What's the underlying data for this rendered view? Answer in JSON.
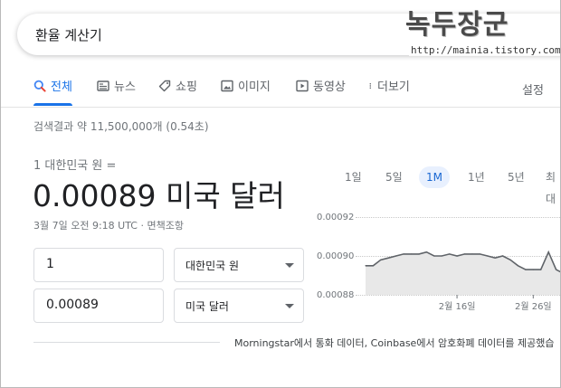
{
  "search": {
    "query": "환율 계산기"
  },
  "watermark": {
    "title": "녹두장군",
    "url": "http://mainia.tistory.com"
  },
  "tabs": [
    {
      "label": "전체",
      "icon": "search-icon",
      "active": true
    },
    {
      "label": "뉴스",
      "icon": "news-icon",
      "active": false
    },
    {
      "label": "쇼핑",
      "icon": "tag-icon",
      "active": false
    },
    {
      "label": "이미지",
      "icon": "image-icon",
      "active": false
    },
    {
      "label": "동영상",
      "icon": "play-icon",
      "active": false
    },
    {
      "label": "더보기",
      "icon": "more-vert-icon",
      "active": false
    }
  ],
  "settings_label": "설정",
  "result_stats": "검색결과 약 11,500,000개 (0.54초)",
  "converter": {
    "from_label": "1 대한민국 원 =",
    "result": "0.00089 미국 달러",
    "timestamp": "3월 7일 오전 9:18 UTC · 면책조항",
    "amount_from": "1",
    "currency_from": "대한민국 원",
    "amount_to": "0.00089",
    "currency_to": "미국 달러",
    "source": "Morningstar에서 통화 데이터, Coinbase에서 암호화폐 데이터를 제공했습"
  },
  "ranges": [
    "1일",
    "5일",
    "1M",
    "1년",
    "5년",
    "최대"
  ],
  "active_range": "1M",
  "colors": {
    "accent": "#1a73e8",
    "line": "#5f6368",
    "area": "#e8e8e8"
  },
  "chart_data": {
    "type": "area",
    "title": "",
    "xlabel": "",
    "ylabel": "",
    "yticks": [
      "0.00092",
      "0.00090",
      "0.00088"
    ],
    "ylim": [
      0.00088,
      0.00092
    ],
    "xticks": [
      {
        "label": "2월 16일",
        "index": 12
      },
      {
        "label": "2월 26일",
        "index": 22
      }
    ],
    "series": [
      {
        "values": [
          0.000895,
          0.000895,
          0.000898,
          0.000899,
          0.0009,
          0.000901,
          0.000901,
          0.000901,
          0.000902,
          0.0009,
          0.0009,
          0.000901,
          0.0009,
          0.000901,
          0.000901,
          0.000901,
          0.0009,
          0.000899,
          0.0009,
          0.000898,
          0.000895,
          0.000893,
          0.000893,
          0.000893,
          0.000902,
          0.000893,
          0.000891
        ]
      }
    ]
  }
}
